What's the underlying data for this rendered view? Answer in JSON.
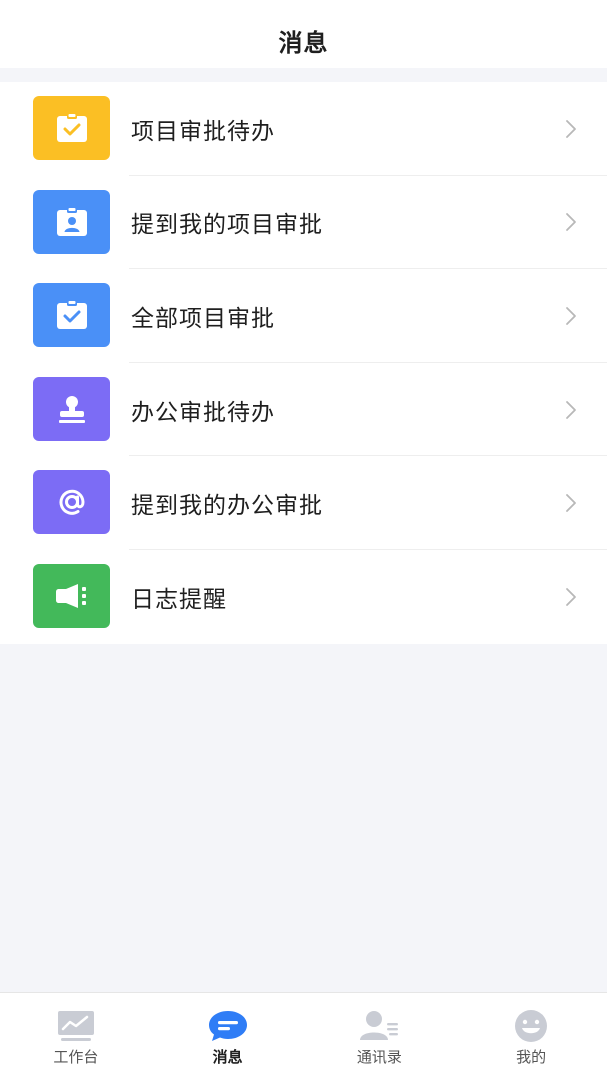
{
  "header": {
    "title": "消息"
  },
  "menu": [
    {
      "label": "项目审批待办",
      "icon": "clipboard-check-icon",
      "color": "#fbbf24"
    },
    {
      "label": "提到我的项目审批",
      "icon": "clipboard-user-icon",
      "color": "#4a90f7"
    },
    {
      "label": "全部项目审批",
      "icon": "clipboard-check-icon",
      "color": "#4a90f7"
    },
    {
      "label": "办公审批待办",
      "icon": "stamp-icon",
      "color": "#7c6cf5"
    },
    {
      "label": "提到我的办公审批",
      "icon": "at-sign-icon",
      "color": "#7c6cf5"
    },
    {
      "label": "日志提醒",
      "icon": "megaphone-icon",
      "color": "#43b95a"
    }
  ],
  "tabbar": {
    "active": "消息",
    "tabs": [
      {
        "label": "工作台",
        "icon": "chart-icon"
      },
      {
        "label": "消息",
        "icon": "chat-bubble-icon"
      },
      {
        "label": "通讯录",
        "icon": "contacts-icon"
      },
      {
        "label": "我的",
        "icon": "smiley-face-icon"
      }
    ]
  },
  "colors": {
    "active_tab": "#2f7df6",
    "inactive_icon": "#c9ccd4",
    "divider": "#eeeeee"
  }
}
